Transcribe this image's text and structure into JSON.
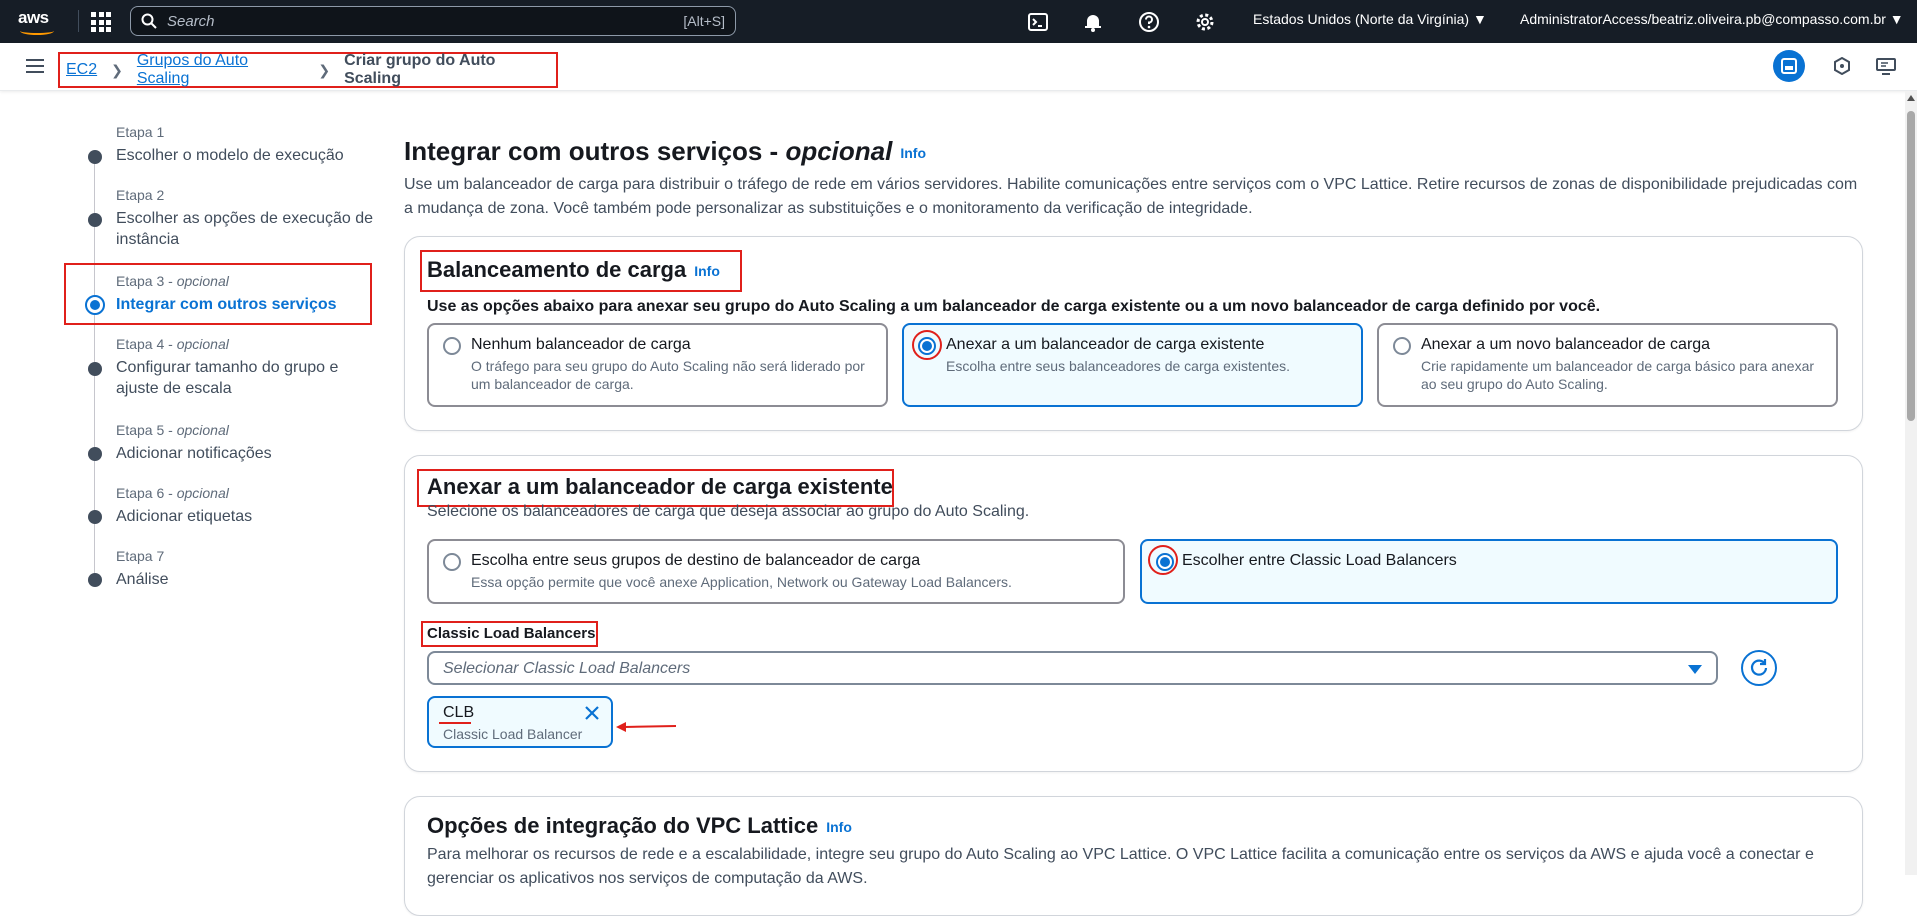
{
  "topnav": {
    "logo_text": "aws",
    "search_placeholder": "Search",
    "search_shortcut": "[Alt+S]",
    "region": "Estados Unidos (Norte da Virgínia) ▼",
    "account": "AdministratorAccess/beatriz.oliveira.pb@compasso.com.br ▼",
    "icons": [
      "apps-icon",
      "cloudshell-icon",
      "bell-icon",
      "help-icon",
      "settings-icon"
    ]
  },
  "breadcrumb": {
    "items": [
      "EC2",
      "Grupos do Auto Scaling"
    ],
    "current": "Criar grupo do Auto Scaling"
  },
  "steps": [
    {
      "num": "Etapa 1",
      "optional": "",
      "label": "Escolher o modelo de execução"
    },
    {
      "num": "Etapa 2",
      "optional": "",
      "label": "Escolher as opções de execução de instância"
    },
    {
      "num": "Etapa 3 - ",
      "optional": "opcional",
      "label": "Integrar com outros serviços"
    },
    {
      "num": "Etapa 4 - ",
      "optional": "opcional",
      "label": "Configurar tamanho do grupo e ajuste de escala"
    },
    {
      "num": "Etapa 5 - ",
      "optional": "opcional",
      "label": "Adicionar notificações"
    },
    {
      "num": "Etapa 6 - ",
      "optional": "opcional",
      "label": "Adicionar etiquetas"
    },
    {
      "num": "Etapa 7",
      "optional": "",
      "label": "Análise"
    }
  ],
  "main": {
    "title": "Integrar com outros serviços - ",
    "title_italic": "opcional",
    "info": "Info",
    "description": "Use um balanceador de carga para distribuir o tráfego de rede em vários servidores. Habilite comunicações entre serviços com o VPC Lattice. Retire recursos de zonas de disponibilidade prejudicadas com a mudança de zona. Você também pode personalizar as substituições e o monitoramento da verificação de integridade."
  },
  "lb_panel": {
    "title": "Balanceamento de carga",
    "info": "Info",
    "subtitle": "Use as opções abaixo para anexar seu grupo do Auto Scaling a um balanceador de carga existente ou a um novo balanceador de carga definido por você.",
    "options": [
      {
        "title": "Nenhum balanceador de carga",
        "desc": "O tráfego para seu grupo do Auto Scaling não será liderado por um balanceador de carga."
      },
      {
        "title": "Anexar a um balanceador de carga existente",
        "desc": "Escolha entre seus balanceadores de carga existentes."
      },
      {
        "title": "Anexar a um novo balanceador de carga",
        "desc": "Crie rapidamente um balanceador de carga básico para anexar ao seu grupo do Auto Scaling."
      }
    ]
  },
  "existing_panel": {
    "title": "Anexar a um balanceador de carga existente",
    "subtitle": "Selecione os balanceadores de carga que deseja associar ao grupo do Auto Scaling.",
    "options": [
      {
        "title": "Escolha entre seus grupos de destino de balanceador de carga",
        "desc": "Essa opção permite que você anexe Application, Network ou Gateway Load Balancers."
      },
      {
        "title": "Escolher entre Classic Load Balancers",
        "desc": ""
      }
    ],
    "field_label": "Classic Load Balancers",
    "select_placeholder": "Selecionar Classic Load Balancers",
    "token_name": "CLB",
    "token_desc": "Classic Load Balancer"
  },
  "vpc_panel": {
    "title": "Opções de integração do VPC Lattice",
    "info": "Info",
    "description": "Para melhorar os recursos de rede e a escalabilidade, integre seu grupo do Auto Scaling ao VPC Lattice. O VPC Lattice facilita a comunicação entre os serviços da AWS e ajuda você a conectar e gerenciar os aplicativos nos serviços de computação da AWS."
  },
  "colors": {
    "accent": "#0972d3",
    "annotation": "#e0201b",
    "nav_bg": "#161d26"
  }
}
